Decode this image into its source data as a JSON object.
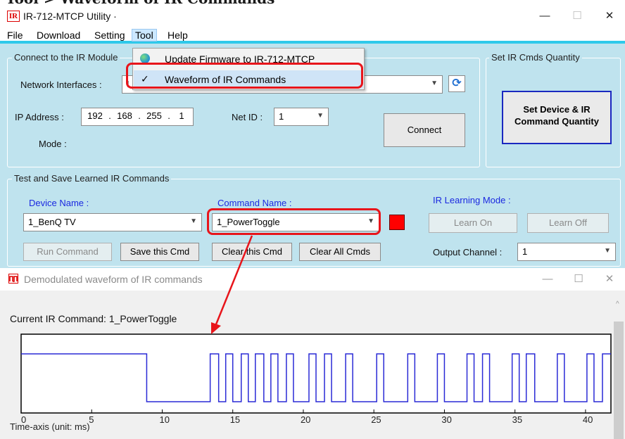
{
  "page": {
    "title_fragment": "Tool > Waveform of IR Commands"
  },
  "main_window": {
    "icon_text": "IR",
    "title": "IR-712-MTCP Utility ·",
    "window_controls": {
      "minimize": "—",
      "maximize": "☐",
      "close": "✕"
    },
    "menu": [
      "File",
      "Download",
      "Setting",
      "Tool",
      "Help"
    ],
    "tool_menu": [
      {
        "label": "Update Firmware to IR-712-MTCP",
        "icon": "globe-icon"
      },
      {
        "label": "Waveform of IR Commands",
        "icon": "check-icon",
        "check": "✓"
      }
    ],
    "connect_group": {
      "title": "Connect to the IR Module",
      "network_label": "Network Interfaces :",
      "network_value": "I",
      "ip_label": "IP Address :",
      "ip": [
        "192",
        "168",
        "255",
        "1"
      ],
      "ip_sep": ".",
      "netid_label": "Net ID :",
      "netid_value": "1",
      "mode_label": "Mode :",
      "connect_button": "Connect"
    },
    "set_group": {
      "title": "Set IR Cmds Quantity",
      "button_line1": "Set Device & IR",
      "button_line2": "Command Quantity"
    },
    "test_group": {
      "title": "Test and Save Learned IR Commands",
      "device_label": "Device Name :",
      "device_value": "1_BenQ TV",
      "command_label": "Command Name :",
      "command_value": "1_PowerToggle",
      "learning_mode_label": "IR Learning Mode :",
      "learn_on": "Learn On",
      "learn_off": "Learn Off",
      "run_command": "Run Command",
      "save_cmd": "Save this Cmd",
      "clear_cmd": "Clear this Cmd",
      "clear_all": "Clear All Cmds",
      "output_channel_label": "Output Channel :",
      "output_channel_value": "1"
    }
  },
  "waveform_window": {
    "title": "Demodulated waveform of IR commands",
    "current_label": "Current IR Command:",
    "current_value": "1_PowerToggle",
    "axis_label": "Time-axis (unit: ms)"
  },
  "colors": {
    "accent": "#2fc9ea",
    "highlight_red": "#e8151b",
    "wave": "#2a2ad6",
    "panel": "#bfe3ee"
  },
  "chart_data": {
    "type": "line",
    "title": "",
    "xlabel": "Time-axis (unit: ms)",
    "ylabel": "",
    "xlim": [
      0,
      41.8
    ],
    "ticks": [
      0,
      5,
      10,
      15,
      20,
      25,
      30,
      35,
      40
    ],
    "levels": [
      "high",
      "low"
    ],
    "series": [
      {
        "steps": [
          [
            0,
            1
          ],
          [
            8.9,
            0
          ],
          [
            13.4,
            1
          ],
          [
            14.0,
            0
          ],
          [
            14.5,
            1
          ],
          [
            15.0,
            0
          ],
          [
            15.6,
            1
          ],
          [
            16.1,
            0
          ],
          [
            16.6,
            1
          ],
          [
            17.2,
            0
          ],
          [
            17.7,
            1
          ],
          [
            18.2,
            0
          ],
          [
            18.8,
            1
          ],
          [
            19.3,
            0
          ],
          [
            20.4,
            1
          ],
          [
            20.9,
            0
          ],
          [
            21.5,
            1
          ],
          [
            22.0,
            0
          ],
          [
            23.0,
            1
          ],
          [
            23.5,
            0
          ],
          [
            25.2,
            1
          ],
          [
            25.7,
            0
          ],
          [
            27.4,
            1
          ],
          [
            27.9,
            0
          ],
          [
            29.5,
            1
          ],
          [
            30.0,
            0
          ],
          [
            31.6,
            1
          ],
          [
            32.1,
            0
          ],
          [
            32.7,
            1
          ],
          [
            33.2,
            0
          ],
          [
            34.8,
            1
          ],
          [
            35.3,
            0
          ],
          [
            35.8,
            1
          ],
          [
            36.4,
            0
          ],
          [
            38.0,
            1
          ],
          [
            38.5,
            0
          ],
          [
            40.1,
            1
          ],
          [
            40.6,
            0
          ],
          [
            41.2,
            1
          ],
          [
            41.8,
            1
          ]
        ]
      }
    ]
  }
}
